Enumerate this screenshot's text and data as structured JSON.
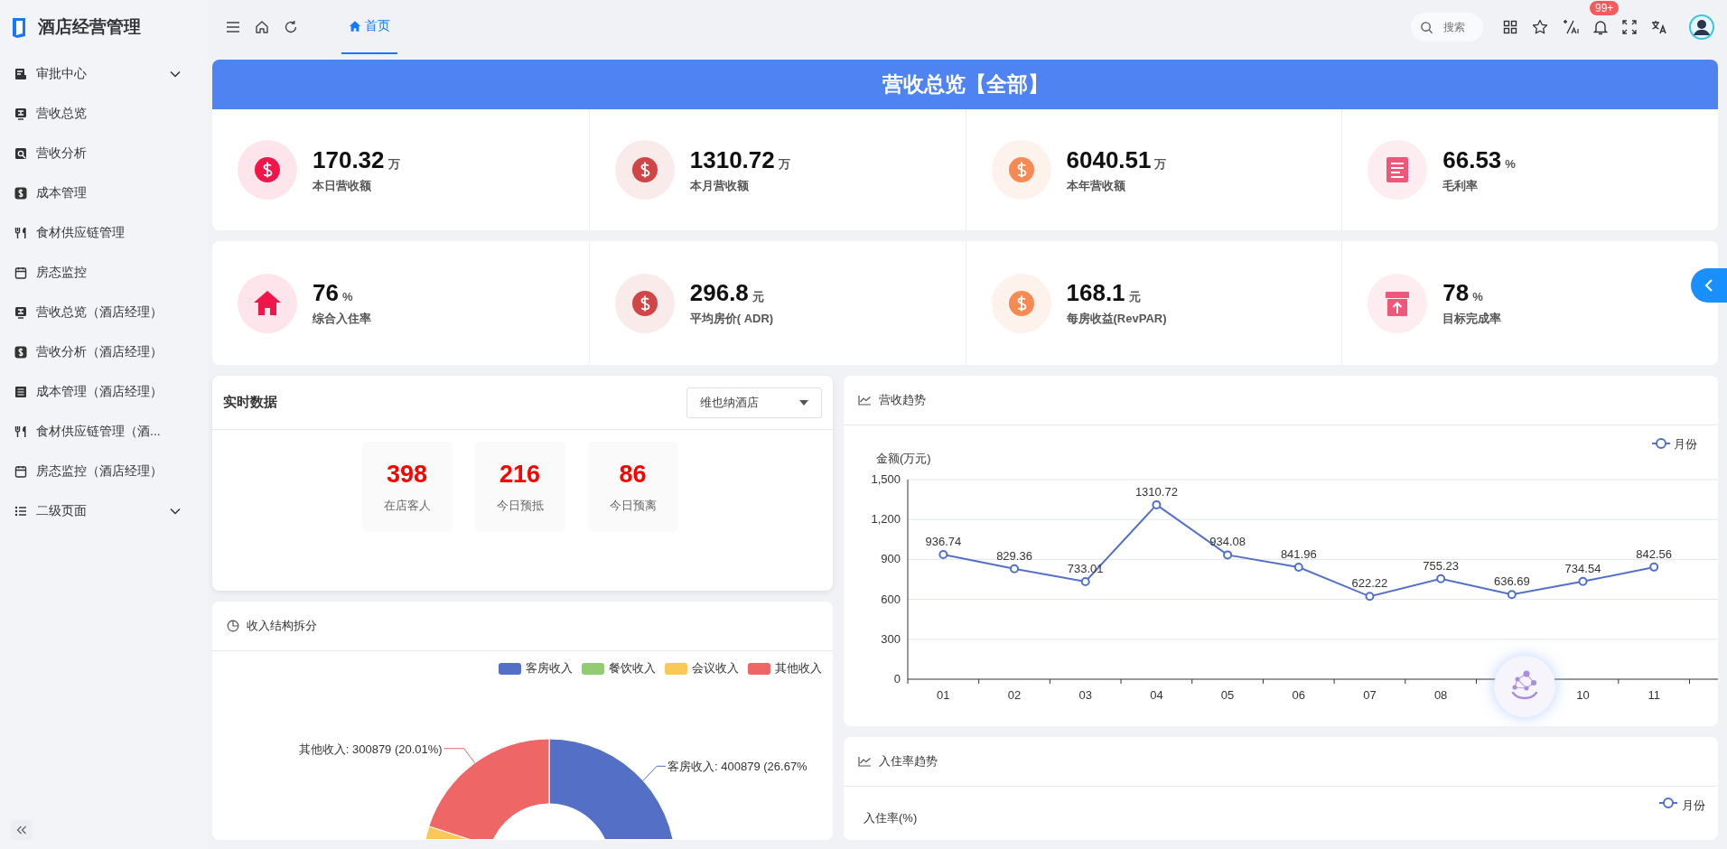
{
  "app": {
    "title": "酒店经营管理"
  },
  "sidebar": {
    "items": [
      {
        "label": "审批中心",
        "has_children": true
      },
      {
        "label": "营收总览",
        "has_children": false
      },
      {
        "label": "营收分析",
        "has_children": false
      },
      {
        "label": "成本管理",
        "has_children": false
      },
      {
        "label": "食材供应链管理",
        "has_children": false
      },
      {
        "label": "房态监控",
        "has_children": false
      },
      {
        "label": "营收总览（酒店经理）",
        "has_children": false
      },
      {
        "label": "营收分析（酒店经理）",
        "has_children": false
      },
      {
        "label": "成本管理（酒店经理）",
        "has_children": false
      },
      {
        "label": "食材供应链管理（酒...",
        "has_children": false
      },
      {
        "label": "房态监控（酒店经理）",
        "has_children": false
      },
      {
        "label": "二级页面",
        "has_children": true
      }
    ]
  },
  "header": {
    "tabs": [
      {
        "label": "首页",
        "selected": true
      }
    ],
    "search": {
      "placeholder": "搜索"
    },
    "notification_badge": "99+"
  },
  "banner": {
    "title": "营收总览【全部】"
  },
  "kpi_rows": [
    [
      {
        "value": "170.32",
        "unit": "万",
        "label": "本日营收额",
        "kind": "money",
        "color": "#f0164a"
      },
      {
        "value": "1310.72",
        "unit": "万",
        "label": "本月营收额",
        "kind": "money",
        "color": "#d04545"
      },
      {
        "value": "6040.51",
        "unit": "万",
        "label": "本年营收额",
        "kind": "money",
        "color": "#f78a52"
      },
      {
        "value": "66.53",
        "unit": "%",
        "label": "毛利率",
        "kind": "margin",
        "color": "#f0567a"
      }
    ],
    [
      {
        "value": "76",
        "unit": "%",
        "label": "综合入住率",
        "kind": "occupancy",
        "color": "#f0164a"
      },
      {
        "value": "296.8",
        "unit": "元",
        "label": "平均房价( ADR)",
        "kind": "money",
        "color": "#d04545"
      },
      {
        "value": "168.1",
        "unit": "元",
        "label": "每房收益(RevPAR)",
        "kind": "money",
        "color": "#f78a52"
      },
      {
        "value": "78",
        "unit": "%",
        "label": "目标完成率",
        "kind": "target",
        "color": "#f0567a"
      }
    ]
  ],
  "realtime": {
    "title": "实时数据",
    "hotel_select": {
      "value": "维也纳酒店"
    },
    "stats": [
      {
        "value": "398",
        "label": "在店客人"
      },
      {
        "value": "216",
        "label": "今日预抵"
      },
      {
        "value": "86",
        "label": "今日预离"
      }
    ]
  },
  "income_structure": {
    "title": "收入结构拆分",
    "legend": [
      {
        "label": "客房收入",
        "color": "#5470c6"
      },
      {
        "label": "餐饮收入",
        "color": "#91cc75"
      },
      {
        "label": "会议收入",
        "color": "#fac858"
      },
      {
        "label": "其他收入",
        "color": "#ee6666"
      }
    ],
    "slice_labels": [
      "客房收入: 400879 (26.67%",
      "其他收入: 300879 (20.01%)"
    ]
  },
  "revenue_trend": {
    "title": "营收趋势",
    "chart_data": {
      "type": "line",
      "ylabel": "金额(万元)",
      "x": [
        1,
        2,
        3,
        4,
        5,
        6,
        7,
        8,
        9,
        10,
        11
      ],
      "xlim": [
        0.5,
        11.9
      ],
      "xticks": [
        {
          "value": 1,
          "label": "01"
        },
        {
          "value": 2,
          "label": "02"
        },
        {
          "value": 3,
          "label": "03"
        },
        {
          "value": 4,
          "label": "04"
        },
        {
          "value": 5,
          "label": "05"
        },
        {
          "value": 6,
          "label": "06"
        },
        {
          "value": 7,
          "label": "07"
        },
        {
          "value": 8,
          "label": "08"
        },
        {
          "value": 10,
          "label": "10"
        },
        {
          "value": 11,
          "label": "11"
        }
      ],
      "ylim": [
        0,
        1500
      ],
      "yticks": [
        {
          "value": 0,
          "label": "0"
        },
        {
          "value": 300,
          "label": "300"
        },
        {
          "value": 600,
          "label": "600"
        },
        {
          "value": 900,
          "label": "900"
        },
        {
          "value": 1200,
          "label": "1,200"
        },
        {
          "value": 1500,
          "label": "1,500"
        }
      ],
      "grid": true,
      "series": [
        {
          "name": "月份",
          "color": "#5470c6",
          "marker": "circle",
          "values": [
            936.74,
            829.36,
            733.01,
            1310.72,
            934.08,
            841.96,
            622.22,
            755.23,
            636.69,
            734.54,
            842.56
          ]
        }
      ],
      "data_labels": true
    }
  },
  "occupancy_trend": {
    "title": "入住率趋势",
    "legend": "月份",
    "ylabel": "入住率(%)"
  }
}
